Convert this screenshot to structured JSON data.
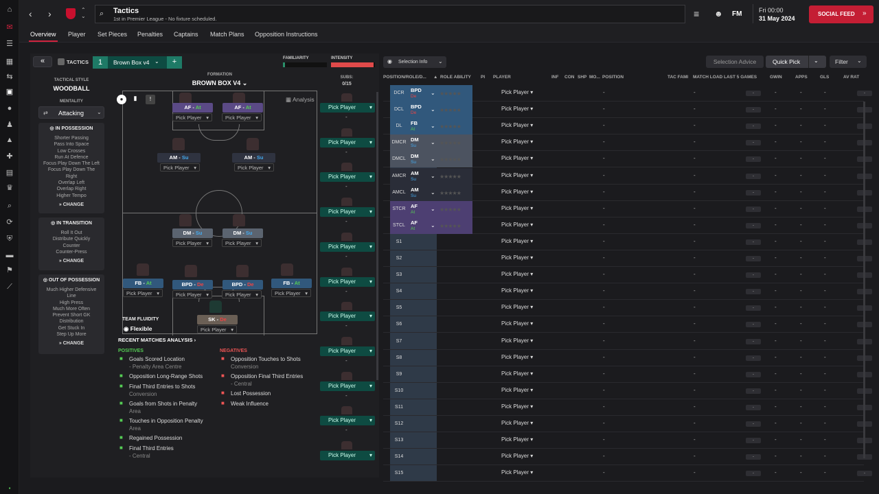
{
  "header": {
    "title": "Tactics",
    "subtitle": "1st in Premier League - No fixture scheduled.",
    "fm_label": "FM",
    "day_time": "Fri 00:00",
    "date": "31 May 2024",
    "social_feed": "SOCIAL FEED"
  },
  "tabs": [
    "Overview",
    "Player",
    "Set Pieces",
    "Penalties",
    "Captains",
    "Match Plans",
    "Opposition Instructions"
  ],
  "tactic": {
    "label": "TACTICS",
    "slot": "1",
    "name": "Brown Box v4",
    "familiarity_label": "FAMILIARITY",
    "intensity_label": "INTENSITY",
    "familiarity": 0.05,
    "intensity": 0.97
  },
  "style": {
    "label": "TACTICAL STYLE",
    "value": "WOODBALL",
    "mentality_label": "MENTALITY",
    "mentality": "Attacking"
  },
  "possession": {
    "title": "IN POSSESSION",
    "items": [
      "Shorter Passing",
      "Pass Into Space",
      "Low Crosses",
      "Run At Defence",
      "Focus Play Down The Left",
      "Focus Play Down The",
      "Right",
      "Overlap Left",
      "Overlap Right",
      "Higher Tempo"
    ],
    "change": "CHANGE"
  },
  "transition": {
    "title": "IN TRANSITION",
    "items": [
      "Roll It Out",
      "Distribute Quickly",
      "Counter",
      "Counter-Press"
    ],
    "change": "CHANGE"
  },
  "outposs": {
    "title": "OUT OF POSSESSION",
    "items": [
      "Much Higher Defensive",
      "Line",
      "High Press",
      "Much More Often",
      "Prevent Short GK",
      "Distribution",
      "Get Stuck In",
      "Step Up More"
    ],
    "change": "CHANGE"
  },
  "formation": {
    "label": "FORMATION",
    "name": "BROWN BOX V4",
    "subs_label": "SUBS:",
    "subs_count": "0/15",
    "analysis": "Analysis",
    "fluidity_label": "TEAM FLUIDITY",
    "fluidity": "Flexible",
    "pick": "Pick Player"
  },
  "pitch_roles": [
    {
      "role": "AF",
      "duty": "At",
      "dc": "green",
      "color": "#5b4a86"
    },
    {
      "role": "AF",
      "duty": "At",
      "dc": "green",
      "color": "#5b4a86"
    },
    {
      "role": "AM",
      "duty": "Su",
      "dc": "blue",
      "color": "#2f3340"
    },
    {
      "role": "AM",
      "duty": "Su",
      "dc": "blue",
      "color": "#2f3340"
    },
    {
      "role": "DM",
      "duty": "Su",
      "dc": "blue",
      "color": "#5b6470"
    },
    {
      "role": "DM",
      "duty": "Su",
      "dc": "blue",
      "color": "#5b6470"
    },
    {
      "role": "FB",
      "duty": "At",
      "dc": "green",
      "color": "#31587c"
    },
    {
      "role": "BPD",
      "duty": "De",
      "dc": "red",
      "color": "#31587c"
    },
    {
      "role": "BPD",
      "duty": "De",
      "dc": "red",
      "color": "#31587c"
    },
    {
      "role": "FB",
      "duty": "At",
      "dc": "green",
      "color": "#31587c"
    },
    {
      "role": "SK",
      "duty": "De",
      "dc": "red",
      "color": "#6a5f55"
    }
  ],
  "analysis": {
    "title": "RECENT MATCHES ANALYSIS",
    "pos_label": "POSITIVES",
    "neg_label": "NEGATIVES",
    "positives": [
      [
        "Goals Scored Location",
        "- Penalty Area Centre"
      ],
      [
        "Opposition Long-Range Shots",
        ""
      ],
      [
        "Final Third Entries to Shots",
        "Conversion"
      ],
      [
        "Goals from Shots in Penalty",
        "Area"
      ],
      [
        "Touches in Opposition Penalty",
        "Area"
      ],
      [
        "Regained Possession",
        ""
      ],
      [
        "Final Third Entries",
        "- Central"
      ]
    ],
    "negatives": [
      [
        "Opposition Touches to Shots",
        "Conversion"
      ],
      [
        "Opposition Final Third Entries",
        "- Central"
      ],
      [
        "Lost Possession",
        ""
      ],
      [
        "Weak Influence",
        ""
      ]
    ]
  },
  "right": {
    "selection_info": "Selection Info",
    "selection_advice": "Selection Advice",
    "quick_pick": "Quick Pick",
    "filter": "Filter",
    "headers": [
      "POSITION/ROLE/D...",
      "ROLE ABILITY",
      "PI",
      "PLAYER",
      "INF",
      "CON",
      "SHP",
      "MO...",
      "POSITION",
      "TAC FAMI",
      "MATCH LOAD LAST 5 GAMES",
      "GWIN",
      "APPS",
      "GLS",
      "AV RAT"
    ],
    "rows": [
      {
        "pos": "DCR",
        "role": "BPD",
        "duty": "De",
        "dc": "red",
        "color": "#31587c"
      },
      {
        "pos": "DCL",
        "role": "BPD",
        "duty": "De",
        "dc": "red",
        "color": "#31587c"
      },
      {
        "pos": "DL",
        "role": "FB",
        "duty": "At",
        "dc": "green",
        "color": "#31587c"
      },
      {
        "pos": "DMCR",
        "role": "DM",
        "duty": "Su",
        "dc": "blue",
        "color": "#4c5360"
      },
      {
        "pos": "DMCL",
        "role": "DM",
        "duty": "Su",
        "dc": "blue",
        "color": "#4c5360"
      },
      {
        "pos": "AMCR",
        "role": "AM",
        "duty": "Su",
        "dc": "blue",
        "color": "#2a2d38"
      },
      {
        "pos": "AMCL",
        "role": "AM",
        "duty": "Su",
        "dc": "blue",
        "color": "#2a2d38"
      },
      {
        "pos": "STCR",
        "role": "AF",
        "duty": "At",
        "dc": "green",
        "color": "#4d3f72"
      },
      {
        "pos": "STCL",
        "role": "AF",
        "duty": "At",
        "dc": "green",
        "color": "#4d3f72"
      },
      {
        "pos": "S1"
      },
      {
        "pos": "S2"
      },
      {
        "pos": "S3"
      },
      {
        "pos": "S4"
      },
      {
        "pos": "S5"
      },
      {
        "pos": "S6"
      },
      {
        "pos": "S7"
      },
      {
        "pos": "S8"
      },
      {
        "pos": "S9"
      },
      {
        "pos": "S10"
      },
      {
        "pos": "S11"
      },
      {
        "pos": "S12"
      },
      {
        "pos": "S13"
      },
      {
        "pos": "S14"
      },
      {
        "pos": "S15"
      }
    ],
    "dash": "-",
    "pick": "Pick Player"
  }
}
